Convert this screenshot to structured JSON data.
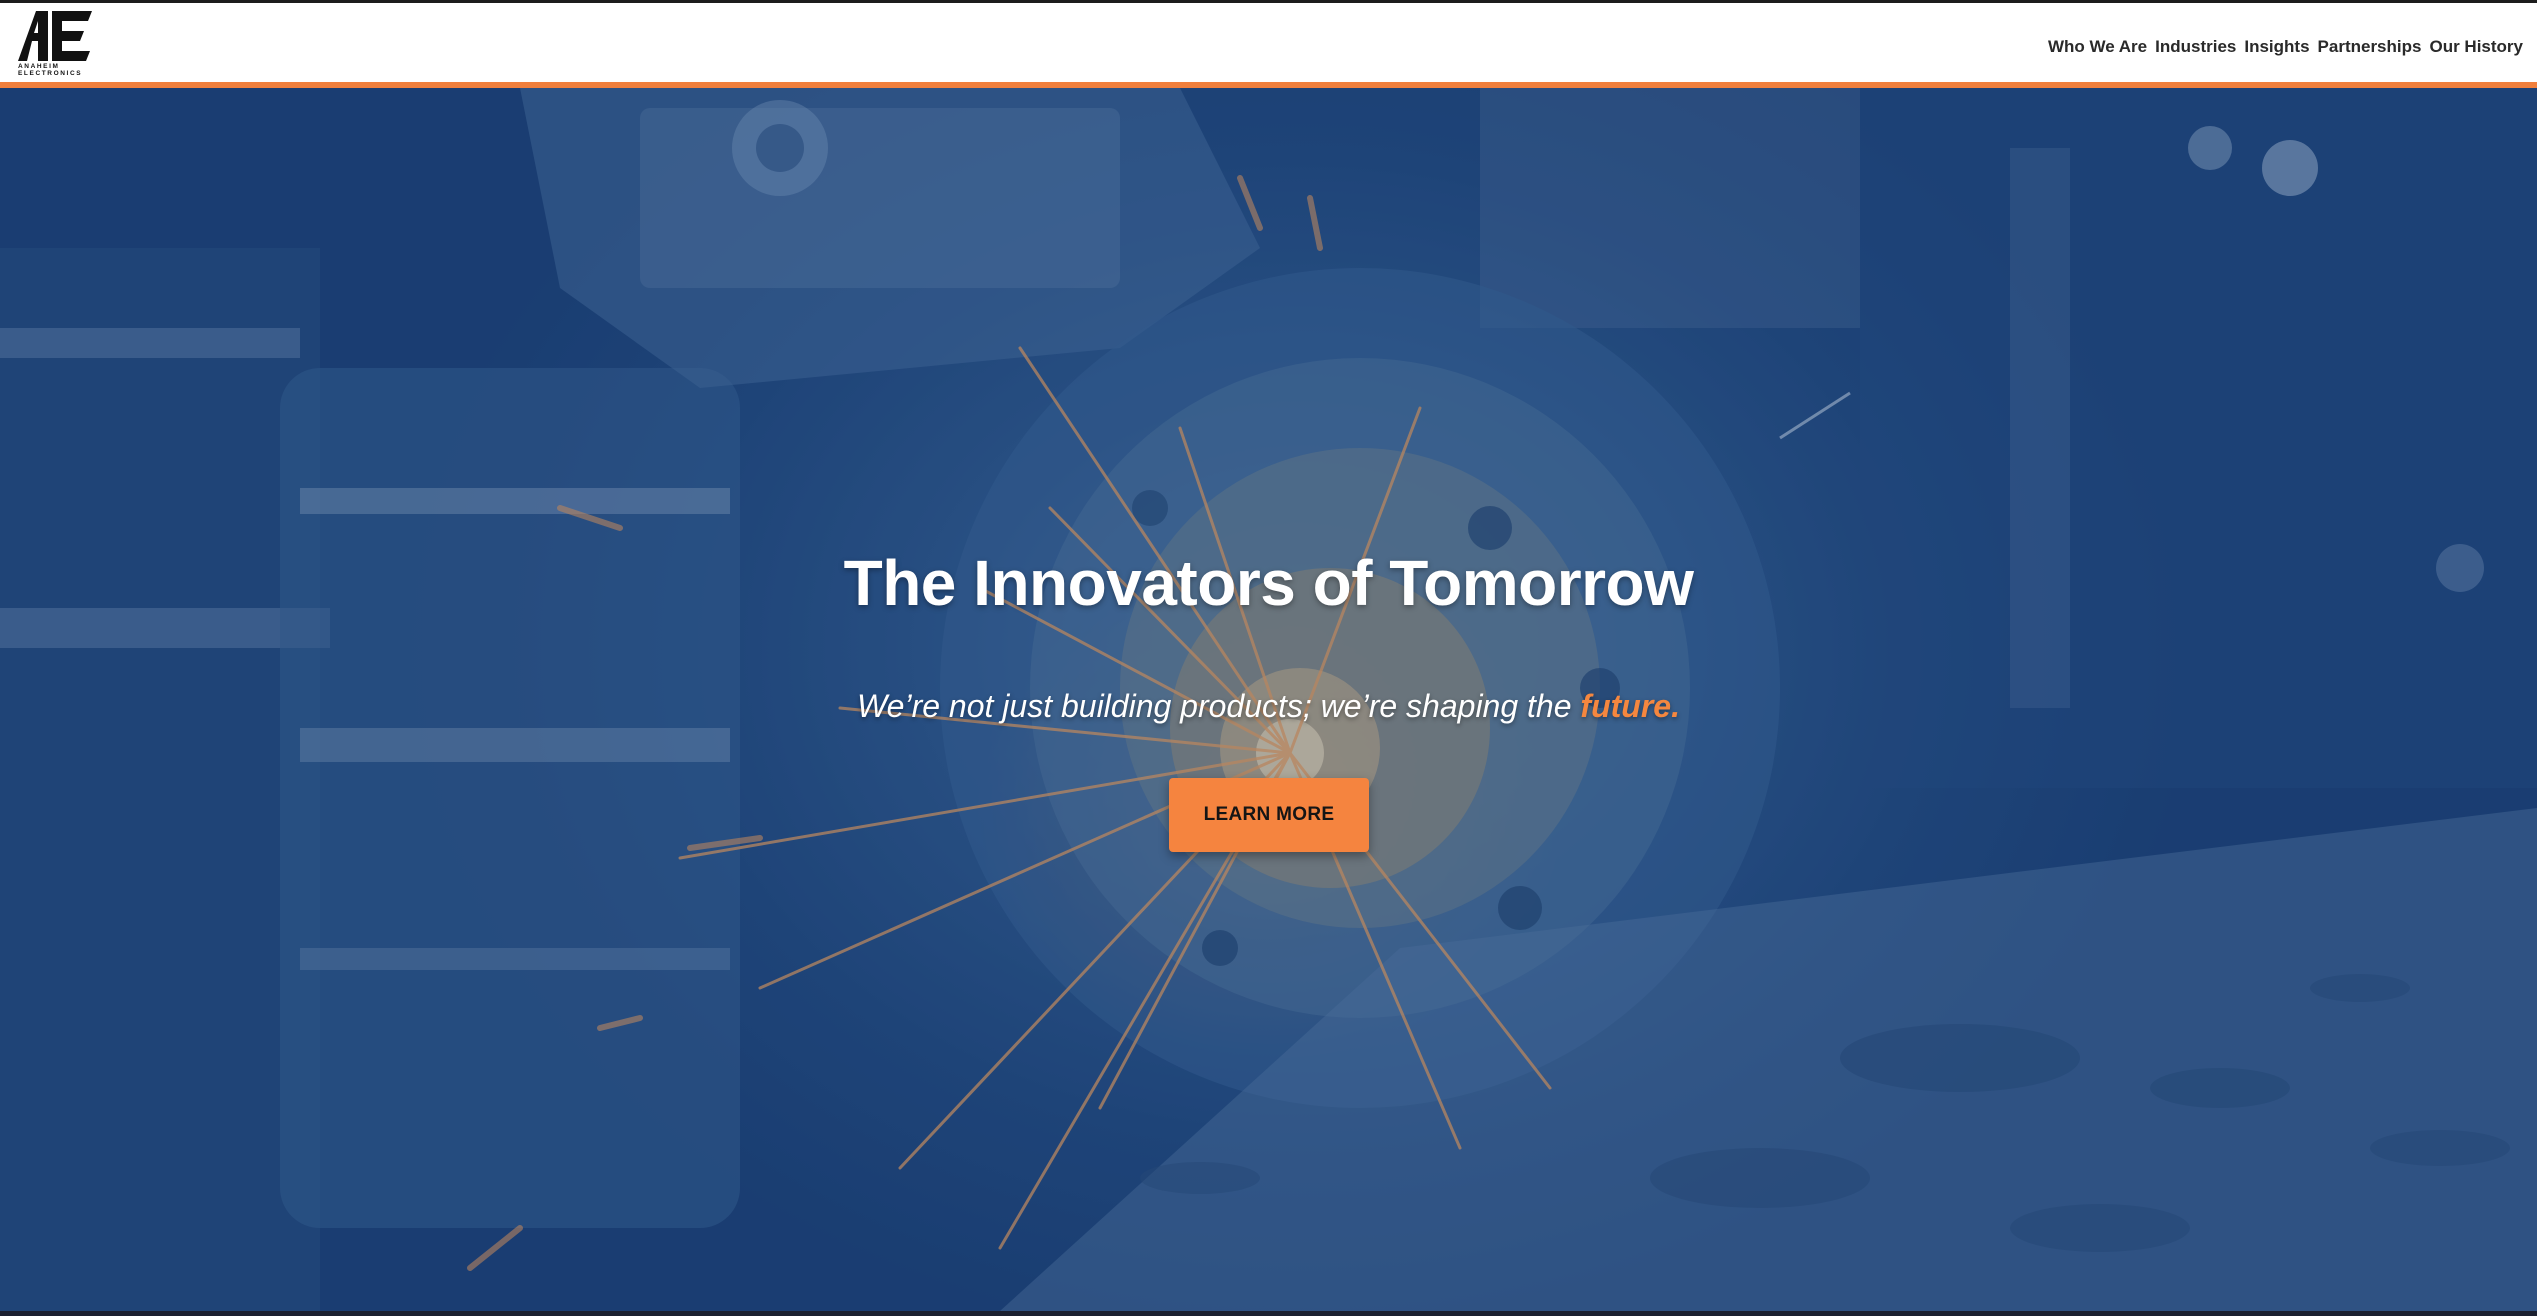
{
  "header": {
    "logo_mark": "AE",
    "logo_line1": "ANAHEIM",
    "logo_line2": "ELECTRONICS",
    "nav": [
      {
        "label": "Who We Are"
      },
      {
        "label": "Industries"
      },
      {
        "label": "Insights"
      },
      {
        "label": "Partnerships"
      },
      {
        "label": "Our History"
      }
    ]
  },
  "hero": {
    "title": "The Innovators of Tomorrow",
    "subtitle_lead": "We’re not just building products; we’re shaping the ",
    "subtitle_accent": "future.",
    "cta_label": "LEARN MORE"
  },
  "colors": {
    "accent": "#f5843f",
    "hero_tint": "#1f4578",
    "header_bg": "#ffffff",
    "nav_text": "#2a2a2a"
  }
}
